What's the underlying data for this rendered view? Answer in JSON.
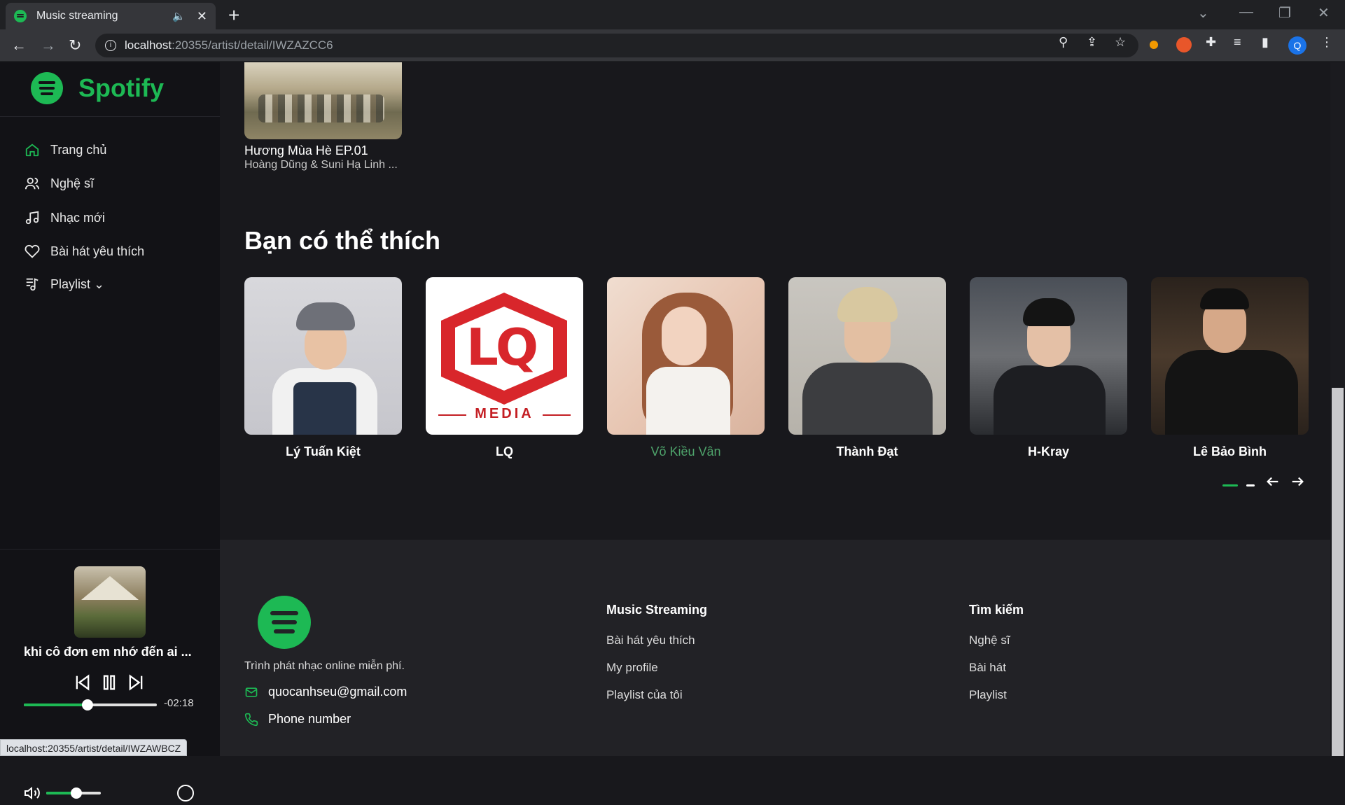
{
  "browser": {
    "tab_title": "Music streaming",
    "url_host": "localhost",
    "url_path": ":20355/artist/detail/IWZAZCC6",
    "profile_initial": "Q",
    "status_url": "localhost:20355/artist/detail/IWZAWBCZ"
  },
  "sidebar": {
    "brand": "Spotify",
    "items": [
      {
        "label": "Trang chủ",
        "icon": "home-icon"
      },
      {
        "label": "Nghệ sĩ",
        "icon": "users-icon"
      },
      {
        "label": "Nhạc mới",
        "icon": "music-note-icon"
      },
      {
        "label": "Bài hát yêu thích",
        "icon": "heart-icon"
      },
      {
        "label": "Playlist ⌄",
        "icon": "playlist-icon"
      }
    ]
  },
  "player": {
    "title": "khi cô đơn em nhớ đến ai ...",
    "time_remaining": "-02:18",
    "progress": 0.48,
    "volume": 0.55
  },
  "album_card": {
    "title": "Hương Mùa Hè EP.01",
    "artists": "Hoàng Dũng & Suni Hạ Linh ..."
  },
  "recommend": {
    "title": "Bạn có thể thích",
    "artists": [
      {
        "name": "Lý Tuấn Kiệt"
      },
      {
        "name": "LQ",
        "logo_text": "LQ",
        "logo_sub": "MEDIA"
      },
      {
        "name": "Võ Kiều Vân"
      },
      {
        "name": "Thành Đạt"
      },
      {
        "name": "H-Kray"
      },
      {
        "name": "Lê Bảo Bình"
      }
    ],
    "page": 1,
    "pages": 2
  },
  "footer": {
    "tagline": "Trình phát nhạc online miễn phí.",
    "email": "quocanhseu@gmail.com",
    "phone": "Phone number",
    "col1": {
      "title": "Music Streaming",
      "links": [
        "Bài hát yêu thích",
        "My profile",
        "Playlist của tôi"
      ]
    },
    "col2": {
      "title": "Tìm kiếm",
      "links": [
        "Nghệ sĩ",
        "Bài hát",
        "Playlist"
      ]
    }
  },
  "colors": {
    "accent": "#1db954",
    "highlight": "#4ea36b",
    "bg": "#18181c"
  }
}
